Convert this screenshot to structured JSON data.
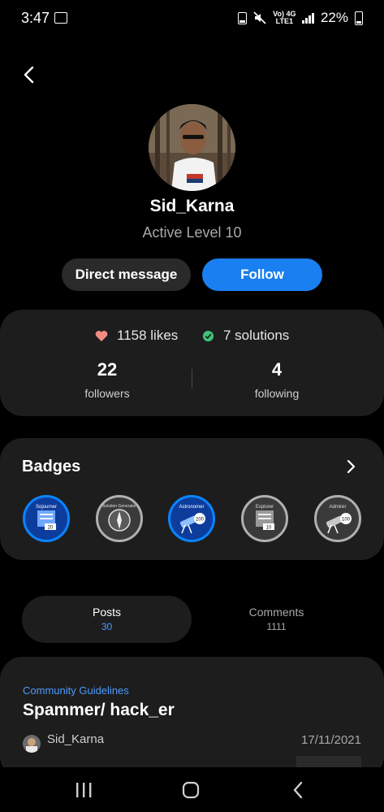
{
  "status_bar": {
    "time": "3:47",
    "network": "Vo) 4G",
    "network_sub": "LTE1",
    "battery": "22%"
  },
  "profile": {
    "username": "Sid_Karna",
    "level": "Active Level 10"
  },
  "actions": {
    "direct_message": "Direct message",
    "follow": "Follow"
  },
  "stats": {
    "likes": "1158 likes",
    "solutions": "7 solutions",
    "followers_count": "22",
    "followers_label": "followers",
    "following_count": "4",
    "following_label": "following"
  },
  "badges": {
    "title": "Badges",
    "items": [
      {
        "name": "Sojourner",
        "earned": true,
        "value": "20"
      },
      {
        "name": "Solution Generator",
        "earned": false
      },
      {
        "name": "Astronomer",
        "earned": true,
        "value": "200"
      },
      {
        "name": "Explorer",
        "earned": false,
        "value": "10"
      },
      {
        "name": "Admirer",
        "earned": false,
        "value": "100"
      }
    ]
  },
  "tabs": [
    {
      "label": "Posts",
      "count": "30",
      "active": true
    },
    {
      "label": "Comments",
      "count": "1111",
      "active": false
    }
  ],
  "post": {
    "category": "Community Guidelines",
    "title": "Spammer/ hack_er",
    "author": "Sid_Karna",
    "date": "17/11/2021"
  },
  "colors": {
    "accent": "#1a7ff0",
    "link": "#4c9bff",
    "card": "#1d1d1d",
    "heart": "#f28b82",
    "check": "#3ec27a"
  }
}
